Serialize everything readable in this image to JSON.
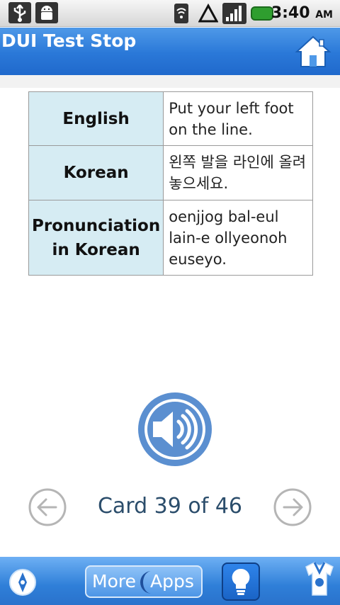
{
  "status_bar": {
    "time": "3:40",
    "ampm": "AM",
    "icons": [
      "usb-icon",
      "android-debug-icon",
      "wifi-icon",
      "sync-icon",
      "signal-icon",
      "battery-icon"
    ]
  },
  "app_bar": {
    "title": "DUI Test Stop",
    "home_icon": "home-icon"
  },
  "card": {
    "rows": [
      {
        "key": "English",
        "value": "Put your left foot on the line."
      },
      {
        "key": "Korean",
        "value": "왼쪽 발을 라인에 올려놓으세요."
      },
      {
        "key": "Pronunciation in Korean",
        "value": "oenjjog bal-eul lain-e ollyeonoh euseyo."
      }
    ]
  },
  "audio": {
    "icon": "speaker-icon"
  },
  "navigation": {
    "prev_icon": "arrow-left-icon",
    "next_icon": "arrow-right-icon",
    "card_counter": "Card 39 of 46"
  },
  "bottom_bar": {
    "compass_icon": "compass-icon",
    "more_label_1": "More",
    "more_label_2": "Apps",
    "bulb_icon": "lightbulb-icon",
    "tshirt_icon": "tshirt-icon"
  },
  "colors": {
    "app_bar": "#2a78d8",
    "key_cell_bg": "#d6ecf3",
    "speaker_blue": "#5b8fd0",
    "counter_text": "#2b4d6b"
  }
}
